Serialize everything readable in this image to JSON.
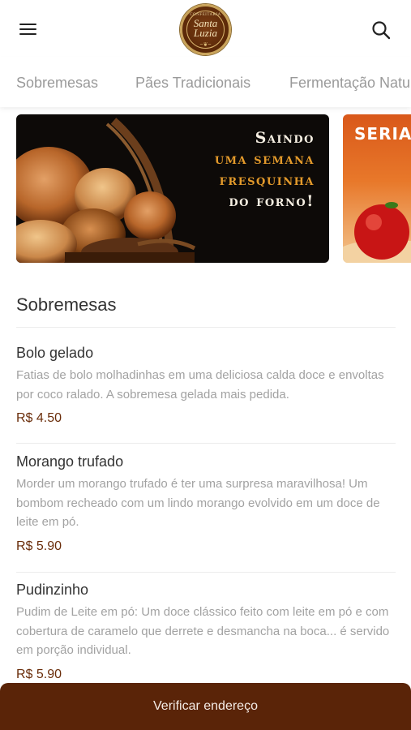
{
  "header": {
    "logo": {
      "top_text": "CONFEITARIA",
      "name": "Santa Luzia"
    }
  },
  "categories": [
    {
      "label": "Sobremesas"
    },
    {
      "label": "Pães Tradicionais"
    },
    {
      "label": "Fermentação Natural"
    }
  ],
  "banners": [
    {
      "lines": [
        "Saindo",
        "uma semana",
        "fresquinha",
        "do forno!"
      ]
    },
    {
      "lines": [
        "Seria"
      ]
    }
  ],
  "section": {
    "title": "Sobremesas"
  },
  "products": [
    {
      "name": "Bolo gelado",
      "description": "Fatias de bolo molhadinhas em uma deliciosa calda doce e envoltas por coco ralado. A sobremesa gelada mais pedida.",
      "price": "R$ 4.50"
    },
    {
      "name": "Morango trufado",
      "description": "Morder um morango trufado é ter uma surpresa maravilhosa! Um bombom recheado com um lindo morango evolvido em um doce de leite em pó.",
      "price": "R$ 5.90"
    },
    {
      "name": "Pudinzinho",
      "description": "Pudim de Leite em pó: Um doce clássico feito com leite em pó e com cobertura de caramelo que derrete e desmancha na boca... é servido em porção individual.",
      "price": "R$ 5.90"
    }
  ],
  "footer": {
    "button_label": "Verificar endereço"
  },
  "colors": {
    "brand": "#5a2408",
    "price": "#6a2d0a",
    "banner_accent": "#e39a2b"
  }
}
